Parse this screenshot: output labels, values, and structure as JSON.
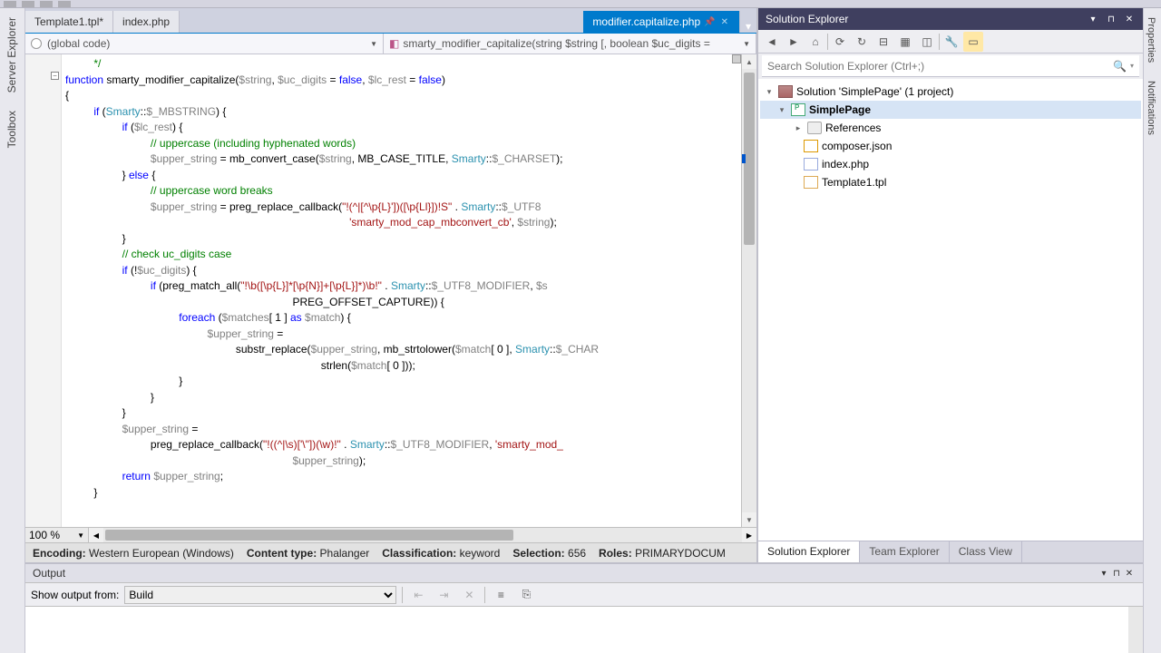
{
  "left_rail": {
    "items": [
      "Server Explorer",
      "Toolbox"
    ]
  },
  "right_rail": {
    "items": [
      "Properties",
      "Notifications"
    ]
  },
  "tabs": [
    {
      "label": "Template1.tpl*",
      "active": false
    },
    {
      "label": "index.php",
      "active": false
    },
    {
      "label": "modifier.capitalize.php",
      "active": true
    }
  ],
  "nav_left": "(global code)",
  "nav_right": "smarty_modifier_capitalize(string $string [, boolean $uc_digits =",
  "zoom": "100 %",
  "status": {
    "encoding_label": "Encoding:",
    "encoding_val": "Western European (Windows)",
    "content_label": "Content type:",
    "content_val": "Phalanger",
    "class_label": "Classification:",
    "class_val": "keyword",
    "sel_label": "Selection:",
    "sel_val": "656",
    "roles_label": "Roles:",
    "roles_val": "PRIMARYDOCUM"
  },
  "solution_explorer": {
    "title": "Solution Explorer",
    "search_placeholder": "Search Solution Explorer (Ctrl+;)",
    "root": "Solution 'SimplePage' (1 project)",
    "project": "SimplePage",
    "nodes": [
      "References",
      "composer.json",
      "index.php",
      "Template1.tpl"
    ],
    "bottom_tabs": [
      "Solution Explorer",
      "Team Explorer",
      "Class View"
    ]
  },
  "output": {
    "title": "Output",
    "show_label": "Show output from:",
    "source": "Build"
  },
  "code_lines": [
    {
      "indent": 1,
      "tokens": [
        [
          "cmt",
          "*/"
        ]
      ]
    },
    {
      "indent": 0,
      "tokens": [
        [
          "kw",
          "function"
        ],
        [
          "pln",
          " smarty_modifier_capitalize("
        ],
        [
          "var",
          "$string"
        ],
        [
          "pln",
          ", "
        ],
        [
          "var",
          "$uc_digits"
        ],
        [
          "pln",
          " = "
        ],
        [
          "kw",
          "false"
        ],
        [
          "pln",
          ", "
        ],
        [
          "var",
          "$lc_rest"
        ],
        [
          "pln",
          " = "
        ],
        [
          "kw",
          "false"
        ],
        [
          "pln",
          ")"
        ]
      ]
    },
    {
      "indent": 0,
      "tokens": [
        [
          "pln",
          "{"
        ]
      ]
    },
    {
      "indent": 1,
      "tokens": [
        [
          "kw",
          "if"
        ],
        [
          "pln",
          " ("
        ],
        [
          "cls",
          "Smarty"
        ],
        [
          "pln",
          "::"
        ],
        [
          "var",
          "$_MBSTRING"
        ],
        [
          "pln",
          ") {"
        ]
      ]
    },
    {
      "indent": 2,
      "tokens": [
        [
          "kw",
          "if"
        ],
        [
          "pln",
          " ("
        ],
        [
          "var",
          "$lc_rest"
        ],
        [
          "pln",
          ") {"
        ]
      ]
    },
    {
      "indent": 3,
      "tokens": [
        [
          "cmt",
          "// uppercase (including hyphenated words)"
        ]
      ]
    },
    {
      "indent": 3,
      "tokens": [
        [
          "var",
          "$upper_string"
        ],
        [
          "pln",
          " = mb_convert_case("
        ],
        [
          "var",
          "$string"
        ],
        [
          "pln",
          ", MB_CASE_TITLE, "
        ],
        [
          "cls",
          "Smarty"
        ],
        [
          "pln",
          "::"
        ],
        [
          "var",
          "$_CHARSET"
        ],
        [
          "pln",
          ");"
        ]
      ]
    },
    {
      "indent": 2,
      "tokens": [
        [
          "pln",
          "} "
        ],
        [
          "kw",
          "else"
        ],
        [
          "pln",
          " {"
        ]
      ]
    },
    {
      "indent": 3,
      "tokens": [
        [
          "cmt",
          "// uppercase word breaks"
        ]
      ]
    },
    {
      "indent": 3,
      "tokens": [
        [
          "var",
          "$upper_string"
        ],
        [
          "pln",
          " = preg_replace_callback("
        ],
        [
          "str",
          "\"!(^|[^\\p{L}'])([\\p{Ll}])!S\""
        ],
        [
          "pln",
          " . "
        ],
        [
          "cls",
          "Smarty"
        ],
        [
          "pln",
          "::"
        ],
        [
          "var",
          "$_UTF8"
        ]
      ]
    },
    {
      "indent": 10,
      "tokens": [
        [
          "str",
          "'smarty_mod_cap_mbconvert_cb'"
        ],
        [
          "pln",
          ", "
        ],
        [
          "var",
          "$string"
        ],
        [
          "pln",
          ");"
        ]
      ]
    },
    {
      "indent": 2,
      "tokens": [
        [
          "pln",
          "}"
        ]
      ]
    },
    {
      "indent": 2,
      "tokens": [
        [
          "cmt",
          "// check uc_digits case"
        ]
      ]
    },
    {
      "indent": 2,
      "tokens": [
        [
          "kw",
          "if"
        ],
        [
          "pln",
          " (!"
        ],
        [
          "var",
          "$uc_digits"
        ],
        [
          "pln",
          ") {"
        ]
      ]
    },
    {
      "indent": 3,
      "tokens": [
        [
          "kw",
          "if"
        ],
        [
          "pln",
          " (preg_match_all("
        ],
        [
          "str",
          "\"!\\b([\\p{L}]*[\\p{N}]+[\\p{L}]*)\\b!\""
        ],
        [
          "pln",
          " . "
        ],
        [
          "cls",
          "Smarty"
        ],
        [
          "pln",
          "::"
        ],
        [
          "var",
          "$_UTF8_MODIFIER"
        ],
        [
          "pln",
          ", "
        ],
        [
          "var",
          "$s"
        ]
      ]
    },
    {
      "indent": 8,
      "tokens": [
        [
          "pln",
          "PREG_OFFSET_CAPTURE)) {"
        ]
      ]
    },
    {
      "indent": 4,
      "tokens": [
        [
          "kw",
          "foreach"
        ],
        [
          "pln",
          " ("
        ],
        [
          "var",
          "$matches"
        ],
        [
          "pln",
          "[ 1 ] "
        ],
        [
          "kw",
          "as"
        ],
        [
          "pln",
          " "
        ],
        [
          "var",
          "$match"
        ],
        [
          "pln",
          ") {"
        ]
      ]
    },
    {
      "indent": 5,
      "tokens": [
        [
          "var",
          "$upper_string"
        ],
        [
          "pln",
          " ="
        ]
      ]
    },
    {
      "indent": 6,
      "tokens": [
        [
          "pln",
          "substr_replace("
        ],
        [
          "var",
          "$upper_string"
        ],
        [
          "pln",
          ", mb_strtolower("
        ],
        [
          "var",
          "$match"
        ],
        [
          "pln",
          "[ 0 ], "
        ],
        [
          "cls",
          "Smarty"
        ],
        [
          "pln",
          "::"
        ],
        [
          "var",
          "$_CHAR"
        ]
      ]
    },
    {
      "indent": 9,
      "tokens": [
        [
          "pln",
          "strlen("
        ],
        [
          "var",
          "$match"
        ],
        [
          "pln",
          "[ 0 ]));"
        ]
      ]
    },
    {
      "indent": 4,
      "tokens": [
        [
          "pln",
          "}"
        ]
      ]
    },
    {
      "indent": 3,
      "tokens": [
        [
          "pln",
          "}"
        ]
      ]
    },
    {
      "indent": 2,
      "tokens": [
        [
          "pln",
          "}"
        ]
      ]
    },
    {
      "indent": 2,
      "tokens": [
        [
          "var",
          "$upper_string"
        ],
        [
          "pln",
          " ="
        ]
      ]
    },
    {
      "indent": 3,
      "tokens": [
        [
          "pln",
          "preg_replace_callback("
        ],
        [
          "str",
          "\"!((^|\\s)['\\\"])(\\w)!\""
        ],
        [
          "pln",
          " . "
        ],
        [
          "cls",
          "Smarty"
        ],
        [
          "pln",
          "::"
        ],
        [
          "var",
          "$_UTF8_MODIFIER"
        ],
        [
          "pln",
          ", "
        ],
        [
          "str",
          "'smarty_mod_"
        ]
      ]
    },
    {
      "indent": 8,
      "tokens": [
        [
          "var",
          "$upper_string"
        ],
        [
          "pln",
          ");"
        ]
      ]
    },
    {
      "indent": 2,
      "tokens": [
        [
          "kw",
          "return"
        ],
        [
          "pln",
          " "
        ],
        [
          "var",
          "$upper_string"
        ],
        [
          "pln",
          ";"
        ]
      ]
    },
    {
      "indent": 1,
      "tokens": [
        [
          "pln",
          "}"
        ]
      ]
    }
  ]
}
